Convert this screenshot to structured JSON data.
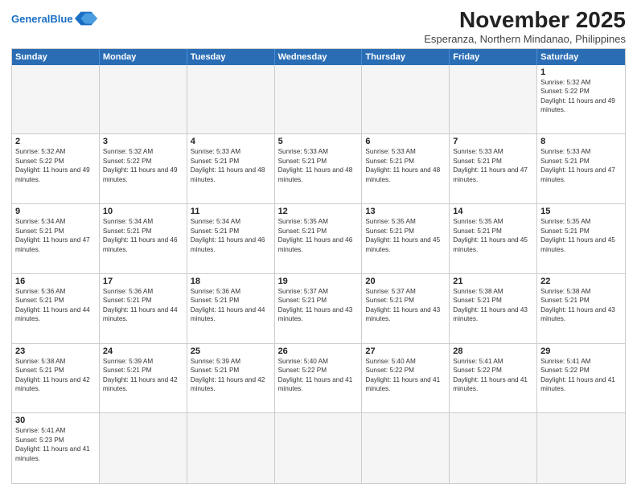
{
  "title": "November 2025",
  "subtitle": "Esperanza, Northern Mindanao, Philippines",
  "logo": {
    "line1": "General",
    "line2": "Blue"
  },
  "days_of_week": [
    "Sunday",
    "Monday",
    "Tuesday",
    "Wednesday",
    "Thursday",
    "Friday",
    "Saturday"
  ],
  "weeks": [
    [
      {
        "day": "",
        "empty": true
      },
      {
        "day": "",
        "empty": true
      },
      {
        "day": "",
        "empty": true
      },
      {
        "day": "",
        "empty": true
      },
      {
        "day": "",
        "empty": true
      },
      {
        "day": "",
        "empty": true
      },
      {
        "day": "1",
        "sunrise": "5:32 AM",
        "sunset": "5:22 PM",
        "daylight": "11 hours and 49 minutes."
      }
    ],
    [
      {
        "day": "2",
        "sunrise": "5:32 AM",
        "sunset": "5:22 PM",
        "daylight": "11 hours and 49 minutes."
      },
      {
        "day": "3",
        "sunrise": "5:32 AM",
        "sunset": "5:22 PM",
        "daylight": "11 hours and 49 minutes."
      },
      {
        "day": "4",
        "sunrise": "5:33 AM",
        "sunset": "5:21 PM",
        "daylight": "11 hours and 48 minutes."
      },
      {
        "day": "5",
        "sunrise": "5:33 AM",
        "sunset": "5:21 PM",
        "daylight": "11 hours and 48 minutes."
      },
      {
        "day": "6",
        "sunrise": "5:33 AM",
        "sunset": "5:21 PM",
        "daylight": "11 hours and 48 minutes."
      },
      {
        "day": "7",
        "sunrise": "5:33 AM",
        "sunset": "5:21 PM",
        "daylight": "11 hours and 47 minutes."
      },
      {
        "day": "8",
        "sunrise": "5:33 AM",
        "sunset": "5:21 PM",
        "daylight": "11 hours and 47 minutes."
      }
    ],
    [
      {
        "day": "9",
        "sunrise": "5:34 AM",
        "sunset": "5:21 PM",
        "daylight": "11 hours and 47 minutes."
      },
      {
        "day": "10",
        "sunrise": "5:34 AM",
        "sunset": "5:21 PM",
        "daylight": "11 hours and 46 minutes."
      },
      {
        "day": "11",
        "sunrise": "5:34 AM",
        "sunset": "5:21 PM",
        "daylight": "11 hours and 46 minutes."
      },
      {
        "day": "12",
        "sunrise": "5:35 AM",
        "sunset": "5:21 PM",
        "daylight": "11 hours and 46 minutes."
      },
      {
        "day": "13",
        "sunrise": "5:35 AM",
        "sunset": "5:21 PM",
        "daylight": "11 hours and 45 minutes."
      },
      {
        "day": "14",
        "sunrise": "5:35 AM",
        "sunset": "5:21 PM",
        "daylight": "11 hours and 45 minutes."
      },
      {
        "day": "15",
        "sunrise": "5:35 AM",
        "sunset": "5:21 PM",
        "daylight": "11 hours and 45 minutes."
      }
    ],
    [
      {
        "day": "16",
        "sunrise": "5:36 AM",
        "sunset": "5:21 PM",
        "daylight": "11 hours and 44 minutes."
      },
      {
        "day": "17",
        "sunrise": "5:36 AM",
        "sunset": "5:21 PM",
        "daylight": "11 hours and 44 minutes."
      },
      {
        "day": "18",
        "sunrise": "5:36 AM",
        "sunset": "5:21 PM",
        "daylight": "11 hours and 44 minutes."
      },
      {
        "day": "19",
        "sunrise": "5:37 AM",
        "sunset": "5:21 PM",
        "daylight": "11 hours and 43 minutes."
      },
      {
        "day": "20",
        "sunrise": "5:37 AM",
        "sunset": "5:21 PM",
        "daylight": "11 hours and 43 minutes."
      },
      {
        "day": "21",
        "sunrise": "5:38 AM",
        "sunset": "5:21 PM",
        "daylight": "11 hours and 43 minutes."
      },
      {
        "day": "22",
        "sunrise": "5:38 AM",
        "sunset": "5:21 PM",
        "daylight": "11 hours and 43 minutes."
      }
    ],
    [
      {
        "day": "23",
        "sunrise": "5:38 AM",
        "sunset": "5:21 PM",
        "daylight": "11 hours and 42 minutes."
      },
      {
        "day": "24",
        "sunrise": "5:39 AM",
        "sunset": "5:21 PM",
        "daylight": "11 hours and 42 minutes."
      },
      {
        "day": "25",
        "sunrise": "5:39 AM",
        "sunset": "5:21 PM",
        "daylight": "11 hours and 42 minutes."
      },
      {
        "day": "26",
        "sunrise": "5:40 AM",
        "sunset": "5:22 PM",
        "daylight": "11 hours and 41 minutes."
      },
      {
        "day": "27",
        "sunrise": "5:40 AM",
        "sunset": "5:22 PM",
        "daylight": "11 hours and 41 minutes."
      },
      {
        "day": "28",
        "sunrise": "5:41 AM",
        "sunset": "5:22 PM",
        "daylight": "11 hours and 41 minutes."
      },
      {
        "day": "29",
        "sunrise": "5:41 AM",
        "sunset": "5:22 PM",
        "daylight": "11 hours and 41 minutes."
      }
    ],
    [
      {
        "day": "30",
        "sunrise": "5:41 AM",
        "sunset": "5:23 PM",
        "daylight": "11 hours and 41 minutes."
      },
      {
        "day": "",
        "empty": true
      },
      {
        "day": "",
        "empty": true
      },
      {
        "day": "",
        "empty": true
      },
      {
        "day": "",
        "empty": true
      },
      {
        "day": "",
        "empty": true
      },
      {
        "day": "",
        "empty": true
      }
    ]
  ]
}
